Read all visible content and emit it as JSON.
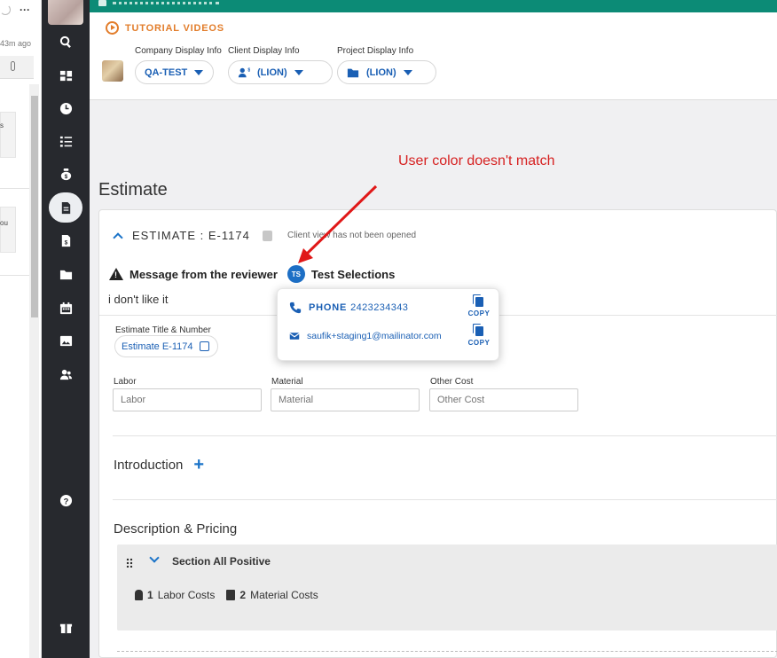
{
  "left_strip": {
    "time": "43m ago",
    "snippet1": "s",
    "snippet2": "ou"
  },
  "tutorial_label": "TUTORIAL VIDEOS",
  "company": {
    "label": "Company Display Info",
    "value": "QA-TEST"
  },
  "client": {
    "label": "Client Display Info",
    "value": "(LION)"
  },
  "project": {
    "label": "Project Display Info",
    "value": "(LION)"
  },
  "annotation": "User color doesn't match",
  "page_title": "Estimate",
  "estimate": {
    "header": "ESTIMATE : E-1174",
    "client_view": "Client view has not been opened",
    "message_heading": "Message from the reviewer",
    "reviewer_initials": "TS",
    "reviewer_name": "Test Selections",
    "message_text": "i don't like it",
    "title_label": "Estimate Title & Number",
    "title_value": "Estimate E-1174"
  },
  "fields": [
    {
      "label": "Labor",
      "placeholder": "Labor"
    },
    {
      "label": "Material",
      "placeholder": "Material"
    },
    {
      "label": "Other Cost",
      "placeholder": "Other Cost"
    }
  ],
  "introduction_label": "Introduction",
  "description_label": "Description & Pricing",
  "section": {
    "title": "Section All Positive",
    "labor_count": "1",
    "labor_label": "Labor Costs",
    "material_count": "2",
    "material_label": "Material Costs"
  },
  "popover": {
    "phone_label": "PHONE",
    "phone_value": "2423234343",
    "email": "saufik+staging1@mailinator.com",
    "copy_label": "COPY"
  },
  "colors": {
    "teal": "#0c8b76",
    "accent": "#1a5fb4",
    "orange": "#e27d2b",
    "annotation": "#d62121",
    "sidebar": "#27292e"
  }
}
